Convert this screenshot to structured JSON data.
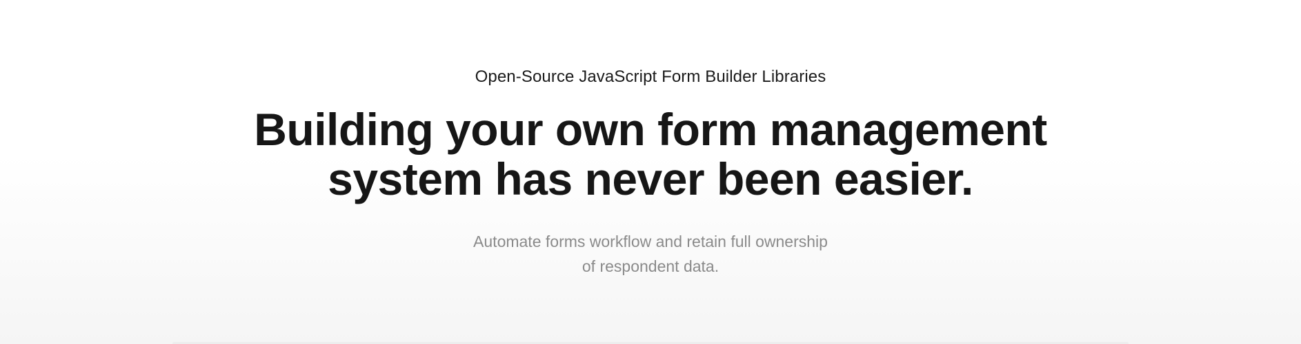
{
  "hero": {
    "eyebrow": "Open-Source JavaScript Form Builder Libraries",
    "headline_line1": "Building your own form management",
    "headline_line2": "system has never been easier.",
    "subhead_line1": "Automate forms workflow and retain full ownership",
    "subhead_line2": "of respondent data."
  },
  "colors": {
    "headline": "#161616",
    "eyebrow": "#1a1a1a",
    "subhead": "#8a8a8a",
    "background_top": "#ffffff",
    "background_bottom": "#f5f5f5"
  }
}
